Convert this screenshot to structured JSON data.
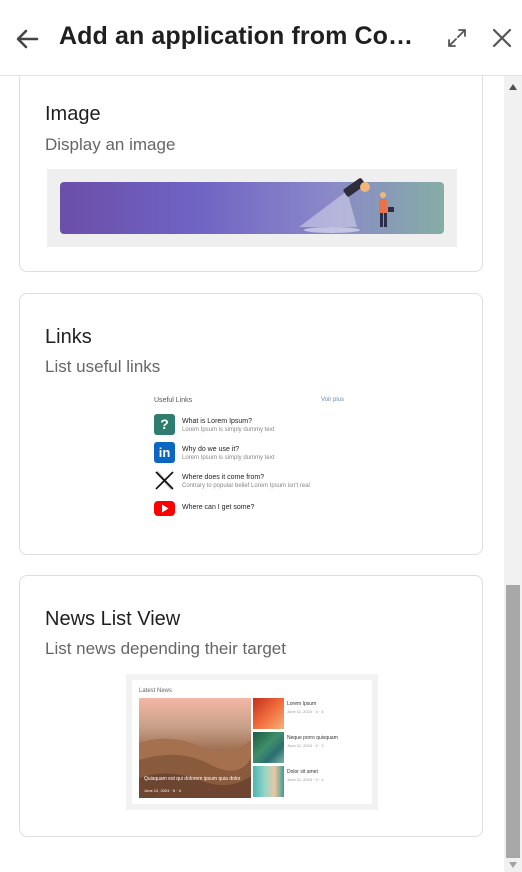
{
  "header": {
    "title": "Add an application from Co…"
  },
  "cards": {
    "image": {
      "title": "Image",
      "description": "Display an image"
    },
    "links": {
      "title": "Links",
      "description": "List useful links",
      "preview": {
        "heading": "Useful Links",
        "more": "Voir plus",
        "items": [
          {
            "icon": "question-icon",
            "title": "What is Lorem Ipsum?",
            "subtitle": "Lorem Ipsum is simply dummy text"
          },
          {
            "icon": "linkedin-icon",
            "title": "Why do we use it?",
            "subtitle": "Lorem Ipsum is simply dummy text"
          },
          {
            "icon": "x-logo-icon",
            "title": "Where does it come from?",
            "subtitle": "Contrary to popular belief Lorem Ipsum isn't real"
          },
          {
            "icon": "youtube-icon",
            "title": "Where can I get some?",
            "subtitle": ""
          }
        ]
      }
    },
    "news": {
      "title": "News List View",
      "description": "List news depending their target",
      "preview": {
        "heading": "Latest News",
        "main_caption": "Quisquam est qui dolorem ipsum quia dolor",
        "main_meta": "June 12, 2024 · 6 · 4",
        "items": [
          {
            "title": "Lorem Ipsum",
            "meta": "June 11, 2024 · 0 · 4"
          },
          {
            "title": "Neque porro quisquam",
            "meta": "June 11, 2024 · 0 · 3"
          },
          {
            "title": "Dolor sit amet",
            "meta": "June 11, 2024 · 0 · 4"
          }
        ]
      }
    }
  },
  "colors": {
    "linkedin": "#0a66c2",
    "question": "#2e7d6f",
    "youtube": "#ff0000",
    "banner_start": "#6a5bb5",
    "banner_end": "#7fa6a0"
  }
}
